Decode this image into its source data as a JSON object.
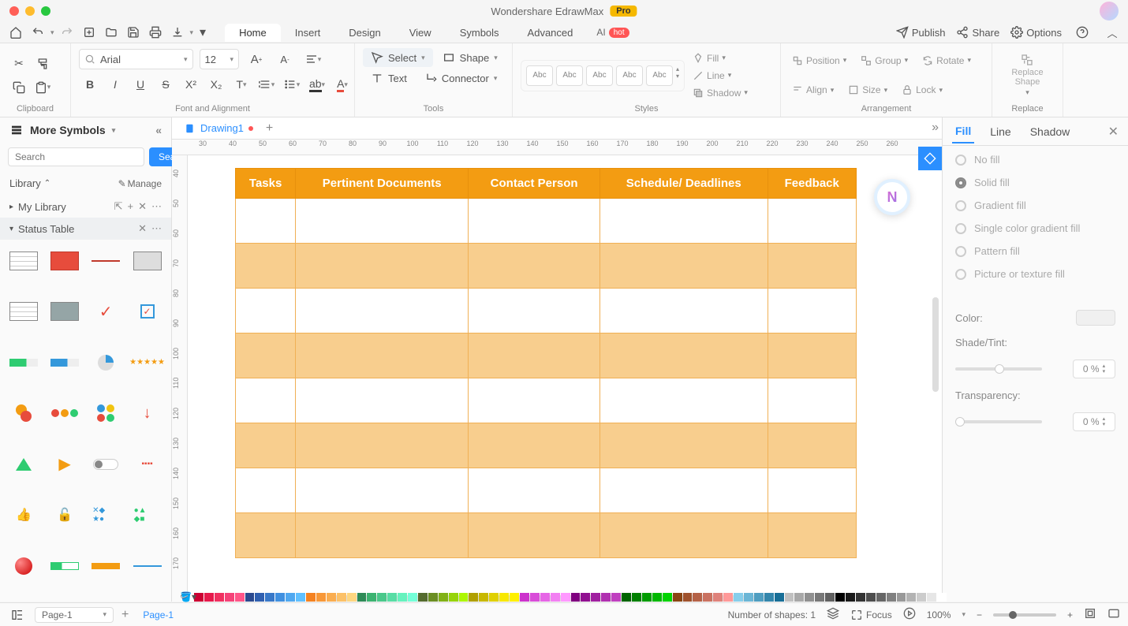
{
  "app": {
    "title": "Wondershare EdrawMax",
    "badge": "Pro"
  },
  "menubar": {
    "tabs": [
      "Home",
      "Insert",
      "Design",
      "View",
      "Symbols",
      "Advanced"
    ],
    "ai_label": "AI",
    "ai_badge": "hot",
    "publish": "Publish",
    "share": "Share",
    "options": "Options"
  },
  "ribbon": {
    "clipboard_label": "Clipboard",
    "font_label": "Font and Alignment",
    "font_name": "Arial",
    "font_size": "12",
    "tools_label": "Tools",
    "select": "Select",
    "shape": "Shape",
    "text": "Text",
    "connector": "Connector",
    "styles_label": "Styles",
    "style_sample": "Abc",
    "fill": "Fill",
    "line": "Line",
    "shadow": "Shadow",
    "arrangement_label": "Arrangement",
    "position": "Position",
    "group": "Group",
    "rotate": "Rotate",
    "align": "Align",
    "size": "Size",
    "lock": "Lock",
    "replace_label": "Replace",
    "replace_shape": "Replace\nShape"
  },
  "sidebar": {
    "more_symbols": "More Symbols",
    "search_placeholder": "Search",
    "search_btn": "Search",
    "library": "Library",
    "manage": "Manage",
    "my_library": "My Library",
    "status_table": "Status Table"
  },
  "doc": {
    "tab_name": "Drawing1"
  },
  "ruler_h": [
    "30",
    "40",
    "50",
    "60",
    "70",
    "80",
    "90",
    "100",
    "110",
    "120",
    "130",
    "140",
    "150",
    "160",
    "170",
    "180",
    "190",
    "200",
    "210",
    "220",
    "230",
    "240",
    "250",
    "260"
  ],
  "ruler_v": [
    "40",
    "50",
    "60",
    "70",
    "80",
    "90",
    "100",
    "110",
    "120",
    "130",
    "140",
    "150",
    "160",
    "170"
  ],
  "table": {
    "headers": [
      "Tasks",
      "Pertinent Documents",
      "Contact Person",
      "Schedule/ Deadlines",
      "Feedback"
    ],
    "row_count": 8
  },
  "right_panel": {
    "tabs": [
      "Fill",
      "Line",
      "Shadow"
    ],
    "no_fill": "No fill",
    "solid_fill": "Solid fill",
    "gradient_fill": "Gradient fill",
    "single_gradient": "Single color gradient fill",
    "pattern_fill": "Pattern fill",
    "picture_fill": "Picture or texture fill",
    "color_label": "Color:",
    "shade_label": "Shade/Tint:",
    "transparency_label": "Transparency:",
    "shade_val": "0 %",
    "trans_val": "0 %"
  },
  "colorbar": [
    "#cc0033",
    "#e6194b",
    "#f03060",
    "#f54278",
    "#ff5588",
    "#2b4a8f",
    "#3060b0",
    "#3878c8",
    "#4090e0",
    "#50a8f0",
    "#60c0ff",
    "#f58220",
    "#f89838",
    "#faad50",
    "#fcc168",
    "#fed680",
    "#2e8b57",
    "#3cb371",
    "#4ac88b",
    "#58dda5",
    "#66f2be",
    "#74ffd8",
    "#556b2f",
    "#6b8e23",
    "#81b117",
    "#97d40b",
    "#adf700",
    "#b0a000",
    "#c8b800",
    "#e0d000",
    "#f8e800",
    "#fff000",
    "#cc33cc",
    "#d94dd9",
    "#e666e6",
    "#f280f2",
    "#ff99ff",
    "#800080",
    "#901090",
    "#a020a0",
    "#b030b0",
    "#c040c0",
    "#006400",
    "#008000",
    "#009c00",
    "#00b800",
    "#00d400",
    "#8b4513",
    "#a0522d",
    "#b56247",
    "#ca7261",
    "#df827b",
    "#ff9999",
    "#87ceeb",
    "#6bb6d6",
    "#4f9ec1",
    "#3386ac",
    "#176e97",
    "#c0c0c0",
    "#a8a8a8",
    "#909090",
    "#787878",
    "#606060",
    "#000000",
    "#1a1a1a",
    "#333333",
    "#4d4d4d",
    "#666666",
    "#808080",
    "#999999",
    "#b3b3b3",
    "#cccccc",
    "#e6e6e6",
    "#ffffff"
  ],
  "statusbar": {
    "page_sel": "Page-1",
    "page_tab": "Page-1",
    "shapes_label": "Number of shapes: 1",
    "focus": "Focus",
    "zoom": "100%"
  }
}
